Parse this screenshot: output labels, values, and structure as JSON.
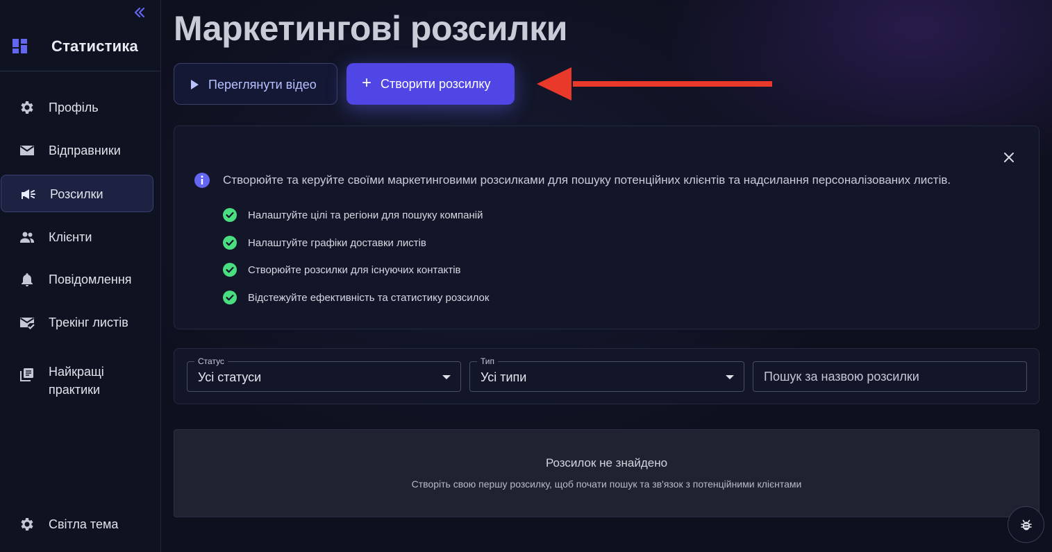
{
  "page": {
    "title": "Маркетингові розсилки"
  },
  "sidebar": {
    "header_title": "Статистика",
    "items": [
      {
        "label": "Профіль",
        "icon": "gear-icon"
      },
      {
        "label": "Відправники",
        "icon": "mail-icon"
      },
      {
        "label": "Розсилки",
        "icon": "megaphone-icon",
        "active": true
      },
      {
        "label": "Клієнти",
        "icon": "people-icon"
      },
      {
        "label": "Повідомлення",
        "icon": "bell-icon"
      },
      {
        "label": "Трекінг листів",
        "icon": "mail-check-icon"
      },
      {
        "label": "Найкращі практики",
        "label_line1": "Найкращі",
        "label_line2": "практики",
        "icon": "library-icon"
      }
    ],
    "theme_label": "Світла тема"
  },
  "actions": {
    "video_label": "Переглянути відео",
    "create_label": "Створити розсилку"
  },
  "info": {
    "intro": "Створюйте та керуйте своїми маркетинговими розсилками для пошуку потенційних клієнтів та надсилання персоналізованих листів.",
    "bullets": [
      "Налаштуйте цілі та регіони для пошуку компаній",
      "Налаштуйте графіки доставки листів",
      "Створюйте розсилки для існуючих контактів",
      "Відстежуйте ефективність та статистику розсилок"
    ]
  },
  "filters": {
    "status": {
      "label": "Статус",
      "value": "Усі статуси"
    },
    "type": {
      "label": "Тип",
      "value": "Усі типи"
    },
    "search": {
      "placeholder": "Пошук за назвою розсилки",
      "value": ""
    }
  },
  "empty": {
    "title": "Розсилок не знайдено",
    "subtitle": "Створіть свою першу розсилку, щоб почати пошук та зв'язок з потенційними клієнтами"
  },
  "colors": {
    "accent": "#4f46e5",
    "accent_icon": "#6366f1",
    "success": "#4ade80",
    "annotation_arrow": "#e8392a"
  }
}
